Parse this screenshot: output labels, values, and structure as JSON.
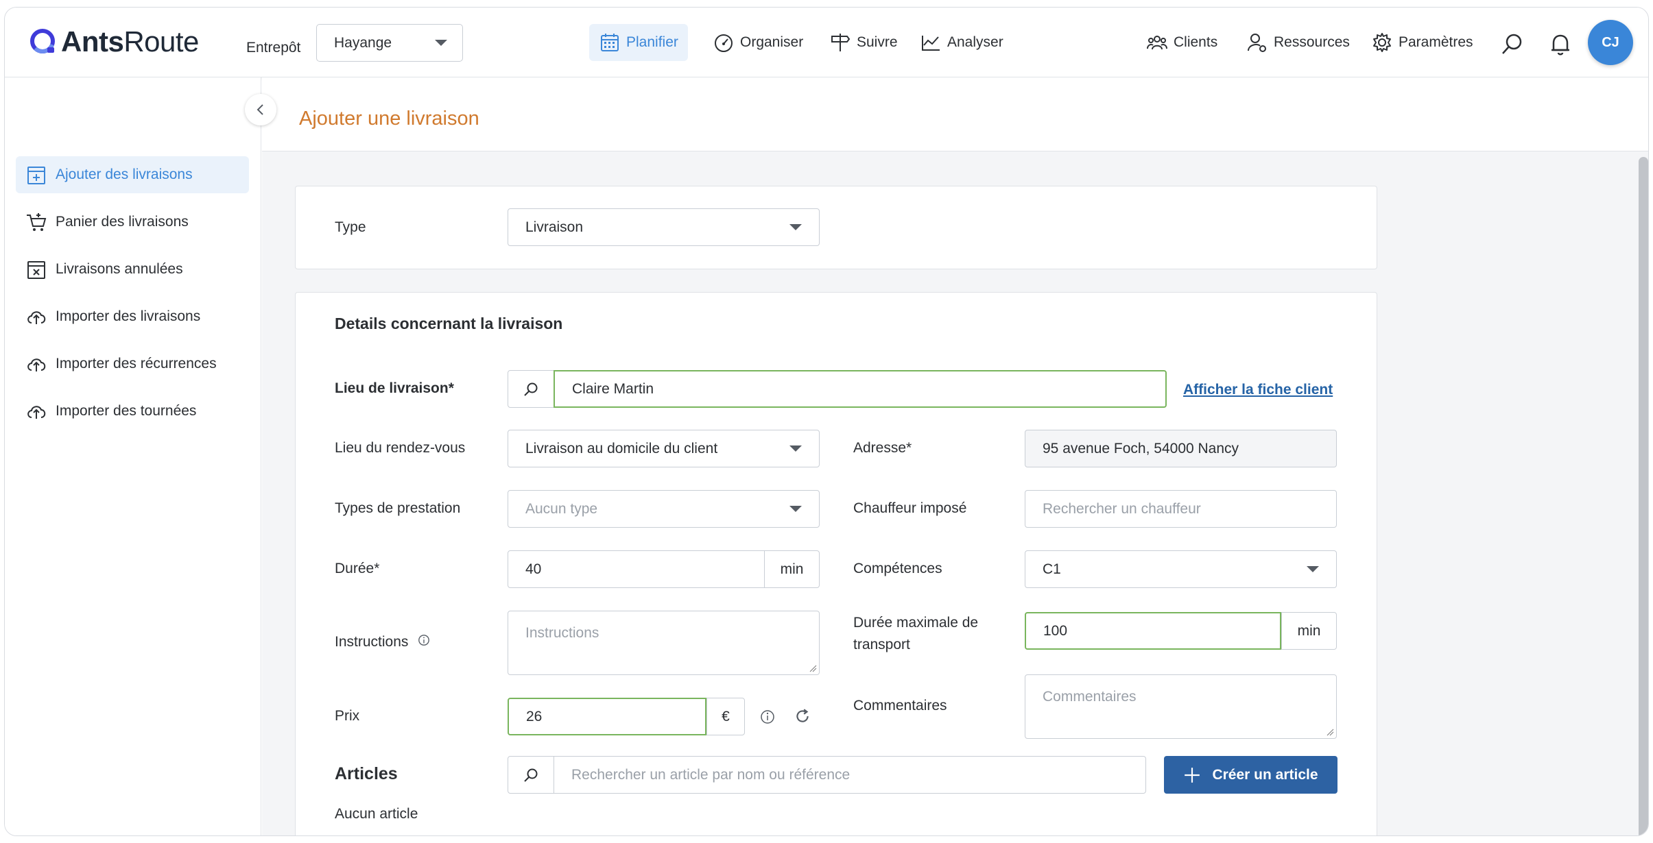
{
  "app": {
    "logo_bold": "Ants",
    "logo_light": "Route",
    "warehouse_label": "Entrepôt",
    "warehouse_value": "Hayange",
    "user_initials": "CJ"
  },
  "nav": {
    "planifier": "Planifier",
    "organiser": "Organiser",
    "suivre": "Suivre",
    "analyser": "Analyser",
    "clients": "Clients",
    "ressources": "Ressources",
    "parametres": "Paramètres"
  },
  "sidebar": {
    "items": [
      {
        "label": "Ajouter des livraisons",
        "active": true
      },
      {
        "label": "Panier des livraisons"
      },
      {
        "label": "Livraisons annulées"
      },
      {
        "label": "Importer des livraisons"
      },
      {
        "label": "Importer des récurrences"
      },
      {
        "label": "Importer des tournées"
      }
    ]
  },
  "page": {
    "title": "Ajouter une livraison"
  },
  "type_card": {
    "label": "Type",
    "value": "Livraison"
  },
  "details": {
    "heading": "Details concernant la livraison",
    "lieu_livraison_label": "Lieu de livraison*",
    "lieu_livraison_value": "Claire Martin",
    "client_link": "Afficher la fiche client",
    "rdv_label": "Lieu du rendez-vous",
    "rdv_value": "Livraison au domicile du client",
    "adresse_label": "Adresse*",
    "adresse_value": "95 avenue Foch, 54000 Nancy",
    "prestation_label": "Types de prestation",
    "prestation_placeholder": "Aucun type",
    "chauffeur_label": "Chauffeur imposé",
    "chauffeur_placeholder": "Rechercher un chauffeur",
    "duree_label": "Durée*",
    "duree_value": "40",
    "duree_unit": "min",
    "competences_label": "Compétences",
    "competences_value": "C1",
    "instructions_label": "Instructions",
    "instructions_placeholder": "Instructions",
    "transport_label_1": "Durée maximale de",
    "transport_label_2": "transport",
    "transport_value": "100",
    "transport_unit": "min",
    "prix_label": "Prix",
    "prix_value": "26",
    "prix_unit": "€",
    "commentaires_label": "Commentaires",
    "commentaires_placeholder": "Commentaires",
    "articles_heading": "Articles",
    "articles_search_placeholder": "Rechercher un article par nom ou référence",
    "create_article": "Créer un article",
    "no_article": "Aucun article"
  },
  "colors": {
    "accent_blue": "#3a86d8",
    "title_orange": "#d07a2e",
    "valid_green": "#79b55d",
    "primary_button": "#2d62a3"
  }
}
